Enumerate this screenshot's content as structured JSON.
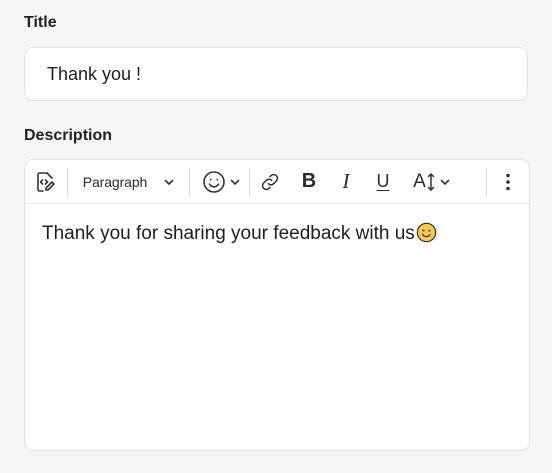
{
  "title_field": {
    "label": "Title",
    "value": "Thank you !"
  },
  "description_field": {
    "label": "Description",
    "toolbar": {
      "source_toggle_icon": "code-view-icon",
      "block_format": "Paragraph",
      "emoji_icon": "emoji-icon",
      "link_icon": "link-icon",
      "bold_label": "B",
      "italic_label": "I",
      "underline_label": "U",
      "font_size_label": "A",
      "more_icon": "more-vertical-icon"
    },
    "content": "Thank you for sharing your feedback with us"
  },
  "colors": {
    "background": "#f6f6f6",
    "surface": "#ffffff",
    "border": "#e2e2e2",
    "emoji_fill": "#f6c94a"
  }
}
